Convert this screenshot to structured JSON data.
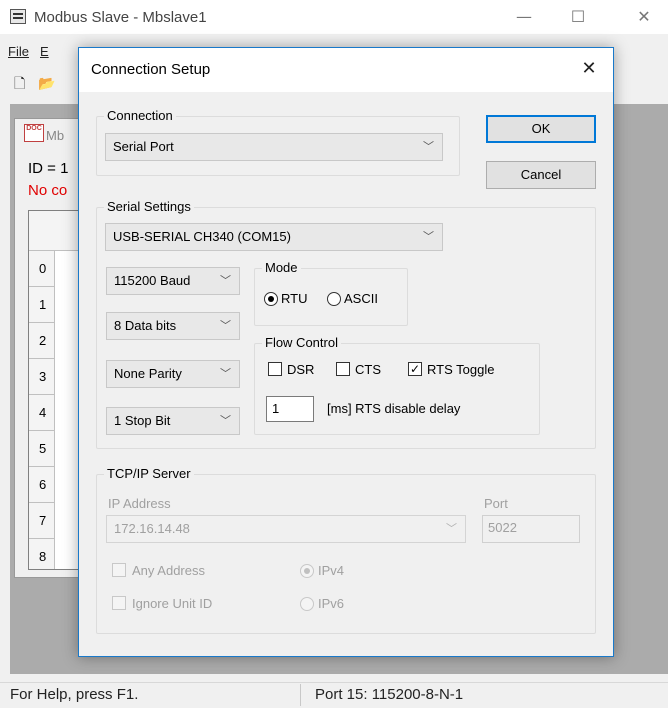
{
  "window": {
    "title": "Modbus Slave - Mbslave1",
    "minimize_icon": "minimize-icon",
    "maximize_icon": "maximize-icon",
    "close_icon": "close-icon"
  },
  "menu": {
    "file": "File",
    "edit_partial": "E"
  },
  "toolbar": {
    "new_icon": "new-document-icon",
    "open_icon": "open-folder-icon"
  },
  "child_window": {
    "title_partial": "Mb",
    "id_text": "ID = 1",
    "status_text": "No co",
    "status_color": "#e00000",
    "row_numbers": [
      "0",
      "1",
      "2",
      "3",
      "4",
      "5",
      "6",
      "7",
      "8"
    ]
  },
  "status_bar": {
    "help_text": "For Help, press F1.",
    "port_text": "Port 15: 115200-8-N-1"
  },
  "dialog": {
    "title": "Connection Setup",
    "close_icon": "close-icon",
    "ok_label": "OK",
    "cancel_label": "Cancel",
    "accent_color": "#0078d7",
    "connection": {
      "group_label": "Connection",
      "selected": "Serial Port"
    },
    "serial": {
      "group_label": "Serial Settings",
      "port": "USB-SERIAL CH340 (COM15)",
      "baud": "115200 Baud",
      "data_bits": "8 Data bits",
      "parity": "None Parity",
      "stop_bits": "1 Stop Bit",
      "mode": {
        "group_label": "Mode",
        "rtu_label": "RTU",
        "ascii_label": "ASCII",
        "selected": "RTU"
      },
      "flow": {
        "group_label": "Flow Control",
        "dsr_label": "DSR",
        "dsr_checked": false,
        "cts_label": "CTS",
        "cts_checked": false,
        "rts_label": "RTS Toggle",
        "rts_checked": true,
        "delay_value": "1",
        "delay_label": "[ms] RTS disable delay"
      }
    },
    "tcp": {
      "group_label": "TCP/IP Server",
      "ip_label": "IP Address",
      "ip_value": "172.16.14.48",
      "port_label": "Port",
      "port_value": "5022",
      "any_address_label": "Any Address",
      "ignore_unit_label": "Ignore Unit ID",
      "ipv4_label": "IPv4",
      "ipv6_label": "IPv6",
      "selected_ip": "IPv4"
    }
  }
}
